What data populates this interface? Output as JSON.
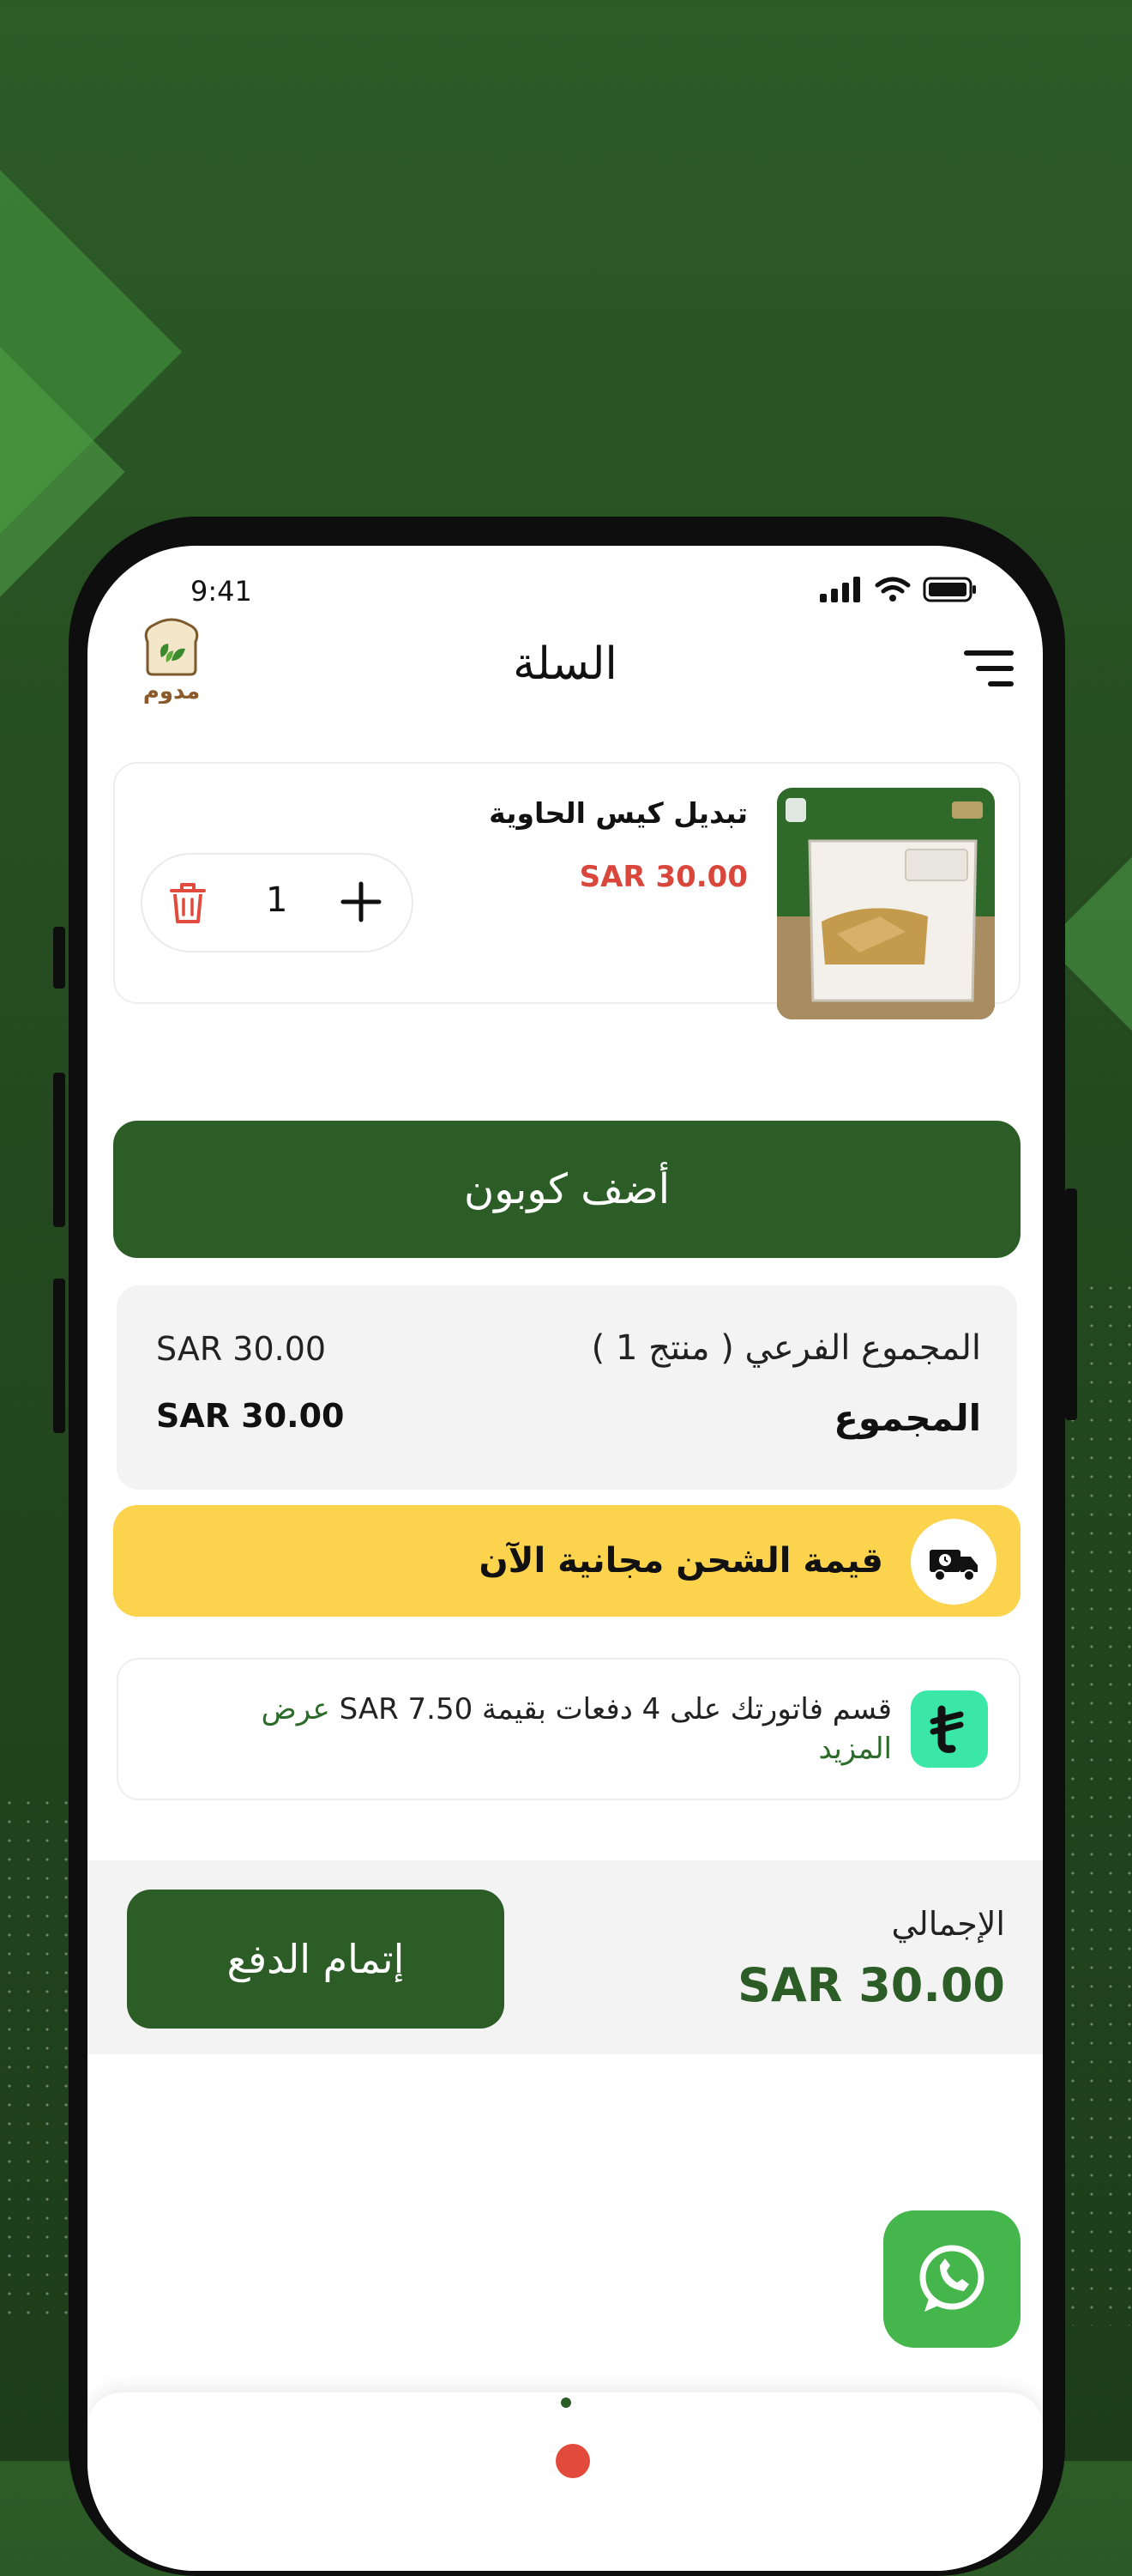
{
  "status_bar": {
    "time": "9:41"
  },
  "header": {
    "title": "السلة",
    "logo_text": "مدوم"
  },
  "cart_item": {
    "name": "تبديل كيس الحاوية",
    "price": "SAR 30.00",
    "quantity": "1"
  },
  "coupon": {
    "label": "أضف كوبون"
  },
  "summary": {
    "subtotal_label": "المجموع الفرعي ( منتج 1 )",
    "subtotal_value": "SAR 30.00",
    "total_label": "المجموع",
    "total_value": "SAR 30.00"
  },
  "shipping_banner": {
    "text": "قيمة الشحن مجانية الآن"
  },
  "installments": {
    "text": "قسم فاتورتك على 4 دفعات بقيمة SAR 7.50",
    "more_link": "عرض المزيد"
  },
  "checkout": {
    "grand_total_label": "الإجمالي",
    "grand_total_value": "SAR 30.00",
    "button_label": "إتمام الدفع"
  },
  "colors": {
    "primary_green": "#2c5d26",
    "price_red": "#d9473c",
    "banner_yellow": "#fcd34d",
    "tabby_green": "#3be7a6",
    "whatsapp_green": "#44b64b"
  },
  "icons": [
    "menu-icon",
    "trash-icon",
    "plus-icon",
    "delivery-truck-icon",
    "tabby-icon",
    "whatsapp-icon",
    "signal-icon",
    "wifi-icon",
    "battery-icon"
  ]
}
